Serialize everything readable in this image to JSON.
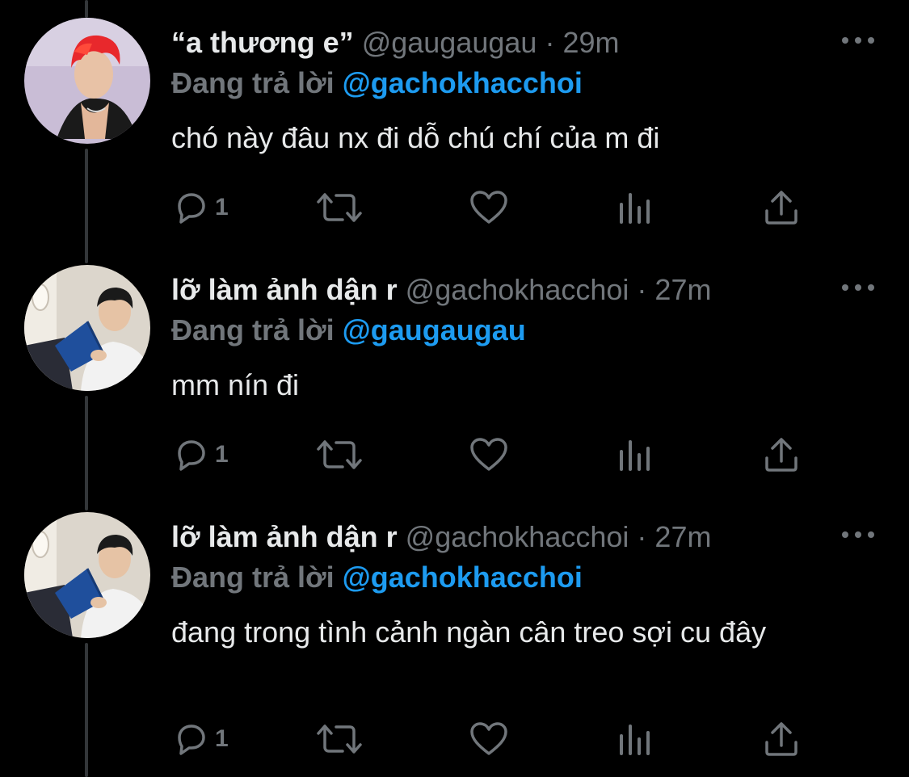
{
  "colors": {
    "background": "#000000",
    "text_primary": "#e7e9ea",
    "text_secondary": "#71767b",
    "link_blue": "#1d9bf0",
    "thread_line": "#333639"
  },
  "icons": [
    "reply-icon",
    "retweet-icon",
    "like-icon",
    "views-icon",
    "share-icon",
    "more-icon"
  ],
  "tweets": [
    {
      "display_name": "“a thương e”",
      "handle": "@gaugaugau",
      "separator": "·",
      "time": "29m",
      "reply_prefix": "Đang trả lời",
      "reply_to": "@gachokhacchoi",
      "text": "chó này đâu nx đi dỗ chú chí của m đi",
      "reply_count": "1"
    },
    {
      "display_name": "lỡ làm ảnh dận r",
      "handle": "@gachokhacchoi",
      "separator": "·",
      "time": "27m",
      "reply_prefix": "Đang trả lời",
      "reply_to": "@gaugaugau",
      "text": "mm nín đi",
      "reply_count": "1"
    },
    {
      "display_name": "lỡ làm ảnh dận r",
      "handle": "@gachokhacchoi",
      "separator": "·",
      "time": "27m",
      "reply_prefix": "Đang trả lời",
      "reply_to": "@gachokhacchoi",
      "text": "đang trong tình cảnh ngàn cân treo sợi cu đây",
      "reply_count": "1"
    }
  ]
}
